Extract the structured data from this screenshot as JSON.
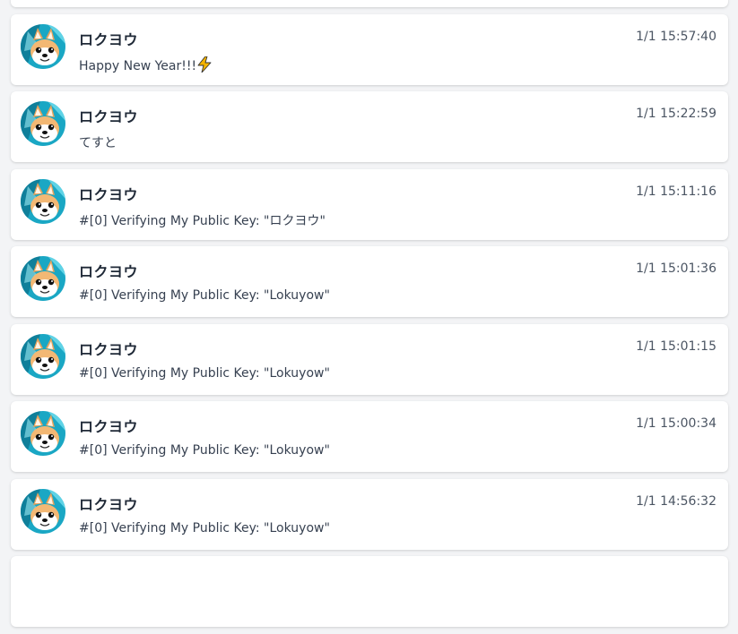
{
  "posts": [
    {
      "author": "ロクヨウ",
      "time": "1/1 15:57:40",
      "content": "Happy New Year!!!",
      "emoji": "lightning-bolt"
    },
    {
      "author": "ロクヨウ",
      "time": "1/1 15:22:59",
      "content": "てすと"
    },
    {
      "author": "ロクヨウ",
      "time": "1/1 15:11:16",
      "content": "#[0] Verifying My Public Key: \"ロクヨウ\""
    },
    {
      "author": "ロクヨウ",
      "time": "1/1 15:01:36",
      "content": "#[0] Verifying My Public Key: \"Lokuyow\""
    },
    {
      "author": "ロクヨウ",
      "time": "1/1 15:01:15",
      "content": "#[0] Verifying My Public Key: \"Lokuyow\""
    },
    {
      "author": "ロクヨウ",
      "time": "1/1 15:00:34",
      "content": "#[0] Verifying My Public Key: \"Lokuyow\""
    },
    {
      "author": "ロクヨウ",
      "time": "1/1 14:56:32",
      "content": "#[0] Verifying My Public Key: \"Lokuyow\""
    }
  ],
  "colors": {
    "background": "#f3f4f6",
    "card": "#ffffff",
    "author": "#1f2937",
    "timestamp": "#4b5563",
    "bolt": "#f5b400"
  },
  "icons": {
    "avatar": "shiba-dog-avatar",
    "emoji": "lightning-bolt-icon"
  }
}
